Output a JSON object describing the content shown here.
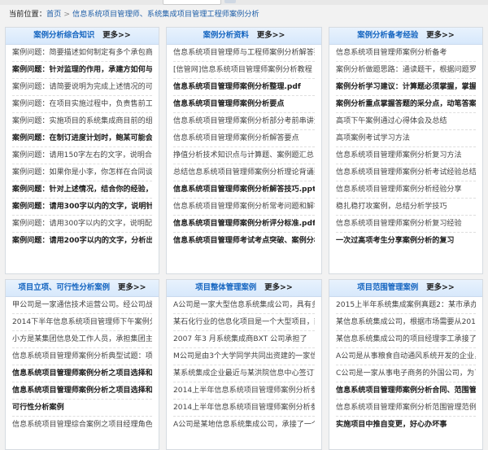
{
  "breadcrumb": {
    "label": "当前位置：",
    "home": "首页",
    "current": "信息系统项目管理师、系统集成项目管理工程师案例分析"
  },
  "panels": [
    {
      "title": "案例分析综合知识",
      "more": "更多>>",
      "items": [
        {
          "text": "案例问题：简要描述如何制定有多个承包商参与的项",
          "bold": false
        },
        {
          "text": "案例问题：针对监理的作用，承建方如何与监理协同",
          "bold": true
        },
        {
          "text": "案例问题：请简要说明为完成上述情况的可能原因有哪",
          "bold": false
        },
        {
          "text": "案例问题：在项目实施过程中，负责售前工作的李某",
          "bold": false
        },
        {
          "text": "案例问题：实施项目的系统集成商目前的组织类型",
          "bold": false
        },
        {
          "text": "案例问题：在制订进度计划时，鲍某可能会采取哪些",
          "bold": true
        },
        {
          "text": "案例问题：请用150字左右的文字，说明合同的作",
          "bold": false
        },
        {
          "text": "案例问题：如果你是小李，你怎样在合同谈判、计划",
          "bold": false
        },
        {
          "text": "案例问题：针对上述情况，结合你的经验，请用15",
          "bold": true
        },
        {
          "text": "案例问题：请用300字以内的文字，说明针对目前",
          "bold": true
        },
        {
          "text": "案例问题：请用300字以内的文字，说明配置管理",
          "bold": false
        },
        {
          "text": "案例问题：请用200字以内的文字，分析出现这种",
          "bold": true
        }
      ]
    },
    {
      "title": "案例分析资料",
      "more": "更多>>",
      "items": [
        {
          "text": "信息系统项目管理师与工程师案例分析解答要点专题",
          "bold": false
        },
        {
          "text": "[信管网]信息系统项目管理师案例分析教程",
          "bold": false
        },
        {
          "text": "信息系统项目管理师案例分析整理.pdf",
          "bold": true
        },
        {
          "text": "信息系统项目管理师案例分析要点",
          "bold": true
        },
        {
          "text": "信息系统项目管理师案例分析部分考前串讲资料.pdf",
          "bold": false
        },
        {
          "text": "信息系统项目管理师案例分析解答要点",
          "bold": false
        },
        {
          "text": "挣值分析技术知识点与计算题、案例题汇总",
          "bold": false
        },
        {
          "text": "总结信息系统项目管理师案例分析理论背诵要点",
          "bold": false
        },
        {
          "text": "信息系统项目管理师案例分析解答技巧.ppt",
          "bold": true
        },
        {
          "text": "信息系统项目管理师案例分析常考问题和解答",
          "bold": false
        },
        {
          "text": "信息系统项目管理师案例分析评分标准.pdf",
          "bold": true
        },
        {
          "text": "信息系统项目管理师考试考点突破、案例分析、",
          "bold": true
        }
      ]
    },
    {
      "title": "案例分析备考经验",
      "more": "更多>>",
      "items": [
        {
          "text": "信息系统项目管理师案例分析备考",
          "bold": false
        },
        {
          "text": "案例分析做题思路：通读题干，根据问题罗列考点",
          "bold": false
        },
        {
          "text": "案例分析学习建议：计算题必须掌握，掌握思路和方",
          "bold": true
        },
        {
          "text": "案例分析重点掌握答题的采分点，动笔答案例",
          "bold": true
        },
        {
          "text": "高项下午案例通过心得体会及总结",
          "bold": false
        },
        {
          "text": "高项案例考试学习方法",
          "bold": false
        },
        {
          "text": "信息系统项目管理师案例分析复习方法",
          "bold": false
        },
        {
          "text": "信息系统项目管理师案例分析考试经验总结",
          "bold": false
        },
        {
          "text": "信息系统项目管理师案例分析经验分享",
          "bold": false
        },
        {
          "text": "稳扎稳打攻案例，总结分析学技巧",
          "bold": false
        },
        {
          "text": "信息系统项目管理师案例分析复习经验",
          "bold": false
        },
        {
          "text": "一次过高项考生分享案例分析的复习",
          "bold": true
        }
      ]
    },
    {
      "title": "项目立项、可行性分析案例",
      "more": "更多>>",
      "items": [
        {
          "text": "甲公司是一家通信技术运营公司。经公司战略规划部",
          "bold": false
        },
        {
          "text": "2014下半年信息系统项目管理师下午案例分析第",
          "bold": false
        },
        {
          "text": "小方是某集团信息处工作人员，承担集团主网站、分",
          "bold": false
        },
        {
          "text": "信息系统项目管理师案例分析典型试题：项目选择和",
          "bold": false
        },
        {
          "text": "信息系统项目管理师案例分析之项目选择和可行性研",
          "bold": true
        },
        {
          "text": "信息系统项目管理师案例分析之项目选择和可行性研",
          "bold": true
        },
        {
          "text": "可行性分析案例",
          "bold": true
        },
        {
          "text": "信息系统项目管理综合案例之项目经理角色案例",
          "bold": false
        }
      ]
    },
    {
      "title": "项目整体管理案例",
      "more": "更多>>",
      "items": [
        {
          "text": "A公司是一家大型信息系统集成公司，具有多年的系",
          "bold": false
        },
        {
          "text": "某石化行业的信息化项目是一个大型项目，前期投标",
          "bold": false
        },
        {
          "text": "2007 年3 月系统集成商BXT 公司承担了",
          "bold": false
        },
        {
          "text": "M公司是由3个大学同学共同出资建的一家信息系",
          "bold": false
        },
        {
          "text": "某系统集成企业最近与某洪院信息中心签订了一个法",
          "bold": false
        },
        {
          "text": "2014上半年信息系统项目管理师案例分析参考答",
          "bold": false
        },
        {
          "text": "2014上半年信息系统项目管理师案例分析参考答",
          "bold": false
        },
        {
          "text": "A公司是某地信息系统集成公司，承接了一个政府部门",
          "bold": false
        }
      ]
    },
    {
      "title": "项目范围管理案例",
      "more": "更多>>",
      "items": [
        {
          "text": "2015上半年系统集成案例真题2：某市承办国际",
          "bold": false
        },
        {
          "text": "某信息系统集成公司，根据市场需要从2013年初",
          "bold": false
        },
        {
          "text": "某信息系统集成公司的项目经理李工承接了一家大型",
          "bold": false
        },
        {
          "text": "A公司是从事粮食自动通风系统开发的企业，",
          "bold": false
        },
        {
          "text": "C公司是一家从事电子商务的外国公司，为了在中国",
          "bold": false
        },
        {
          "text": "信息系统项目管理师案例分析合同、范围管理范例",
          "bold": true
        },
        {
          "text": "信息系统项目管理师案例分析范围管理范例解读",
          "bold": false
        },
        {
          "text": "实施项目中推自变更，好心办坏事",
          "bold": true
        }
      ]
    }
  ]
}
